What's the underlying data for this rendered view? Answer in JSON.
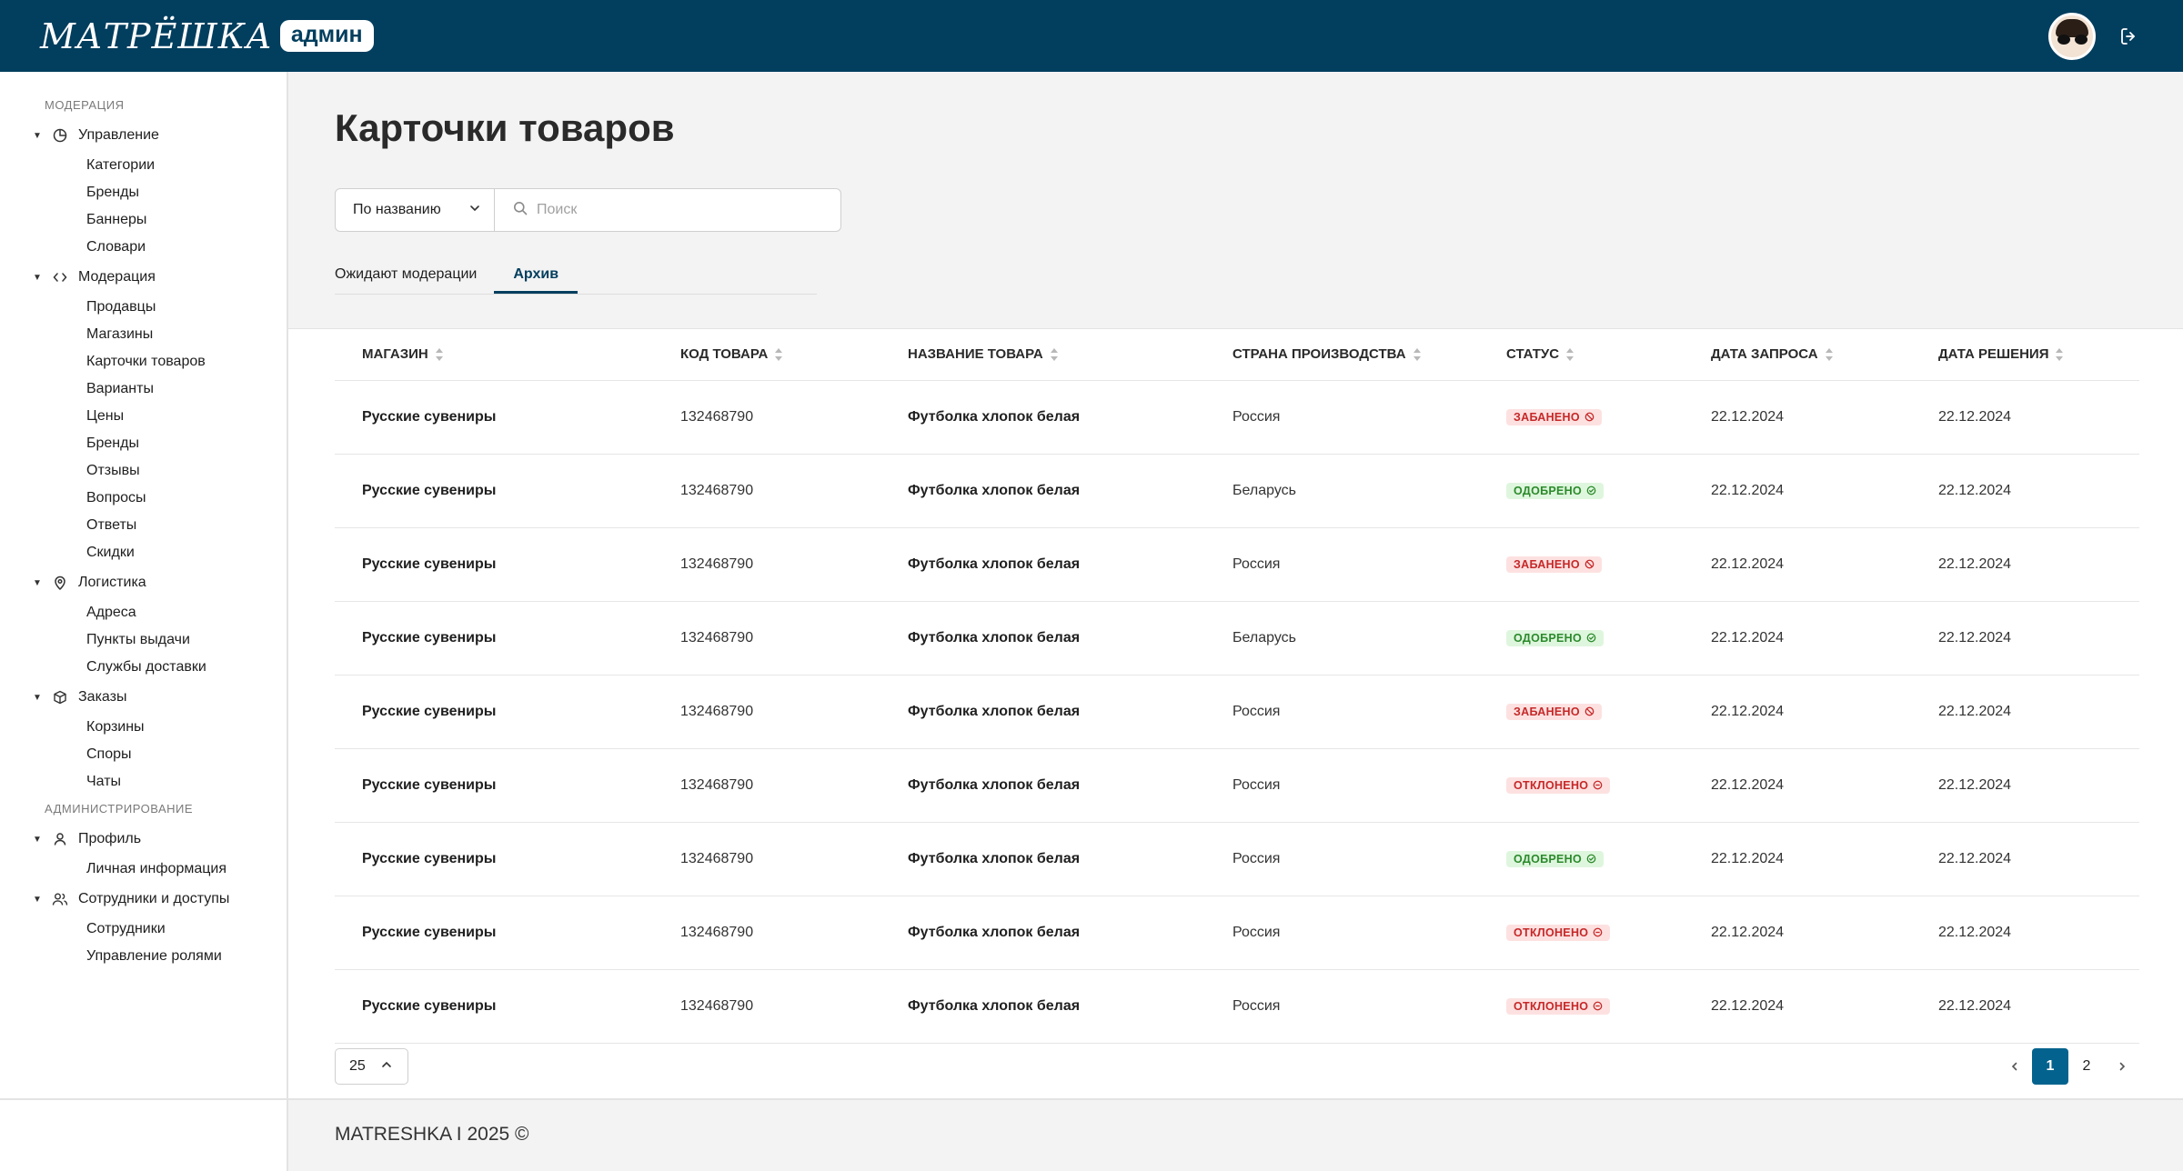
{
  "header": {
    "logo_text": "МАТРЁШКА",
    "logo_badge": "админ"
  },
  "sidebar": {
    "section_moderation": "МОДЕРАЦИЯ",
    "section_admin": "АДМИНИСТРИРОВАНИЕ",
    "groups": [
      {
        "label": "Управление",
        "items": [
          "Категории",
          "Бренды",
          "Баннеры",
          "Словари"
        ]
      },
      {
        "label": "Модерация",
        "items": [
          "Продавцы",
          "Магазины",
          "Карточки товаров",
          "Варианты",
          "Цены",
          "Бренды",
          "Отзывы",
          "Вопросы",
          "Ответы",
          "Скидки"
        ]
      },
      {
        "label": "Логистика",
        "items": [
          "Адреса",
          "Пункты выдачи",
          "Службы доставки"
        ]
      },
      {
        "label": "Заказы",
        "items": [
          "Корзины",
          "Споры",
          "Чаты"
        ]
      },
      {
        "label": "Профиль",
        "items": [
          "Личная информация"
        ]
      },
      {
        "label": "Сотрудники и доступы",
        "items": [
          "Сотрудники",
          "Управление ролями"
        ]
      }
    ]
  },
  "main": {
    "title": "Карточки товаров",
    "filter_label": "По названию",
    "search_placeholder": "Поиск",
    "tabs": [
      {
        "label": "Ожидают модерации"
      },
      {
        "label": "Архив"
      }
    ]
  },
  "table": {
    "columns": [
      "МАГАЗИН",
      "КОД ТОВАРА",
      "НАЗВАНИЕ ТОВАРА",
      "СТРАНА ПРОИЗВОДСТВА",
      "СТАТУС",
      "ДАТА ЗАПРОСА",
      "ДАТА РЕШЕНИЯ"
    ],
    "rows": [
      {
        "store": "Русские сувениры",
        "code": "132468790",
        "name": "Футболка хлопок белая",
        "country": "Россия",
        "status": "ЗАБАНЕНО",
        "req": "22.12.2024",
        "dec": "22.12.2024"
      },
      {
        "store": "Русские сувениры",
        "code": "132468790",
        "name": "Футболка хлопок белая",
        "country": "Беларусь",
        "status": "ОДОБРЕНО",
        "req": "22.12.2024",
        "dec": "22.12.2024"
      },
      {
        "store": "Русские сувениры",
        "code": "132468790",
        "name": "Футболка хлопок белая",
        "country": "Россия",
        "status": "ЗАБАНЕНО",
        "req": "22.12.2024",
        "dec": "22.12.2024"
      },
      {
        "store": "Русские сувениры",
        "code": "132468790",
        "name": "Футболка хлопок белая",
        "country": "Беларусь",
        "status": "ОДОБРЕНО",
        "req": "22.12.2024",
        "dec": "22.12.2024"
      },
      {
        "store": "Русские сувениры",
        "code": "132468790",
        "name": "Футболка хлопок белая",
        "country": "Россия",
        "status": "ЗАБАНЕНО",
        "req": "22.12.2024",
        "dec": "22.12.2024"
      },
      {
        "store": "Русские сувениры",
        "code": "132468790",
        "name": "Футболка хлопок белая",
        "country": "Россия",
        "status": "ОТКЛОНЕНО",
        "req": "22.12.2024",
        "dec": "22.12.2024"
      },
      {
        "store": "Русские сувениры",
        "code": "132468790",
        "name": "Футболка хлопок белая",
        "country": "Россия",
        "status": "ОДОБРЕНО",
        "req": "22.12.2024",
        "dec": "22.12.2024"
      },
      {
        "store": "Русские сувениры",
        "code": "132468790",
        "name": "Футболка хлопок белая",
        "country": "Россия",
        "status": "ОТКЛОНЕНО",
        "req": "22.12.2024",
        "dec": "22.12.2024"
      },
      {
        "store": "Русские сувениры",
        "code": "132468790",
        "name": "Футболка хлопок белая",
        "country": "Россия",
        "status": "ОТКЛОНЕНО",
        "req": "22.12.2024",
        "dec": "22.12.2024"
      }
    ]
  },
  "pagination": {
    "page_size": "25",
    "pages": [
      "1",
      "2"
    ],
    "current": "1"
  },
  "footer": {
    "text": "MATRESHKA I 2025 ©"
  },
  "colors": {
    "header_bg": "#023e5e",
    "accent": "#04638e",
    "banned": "#c62828",
    "approved": "#2b8a2b"
  }
}
